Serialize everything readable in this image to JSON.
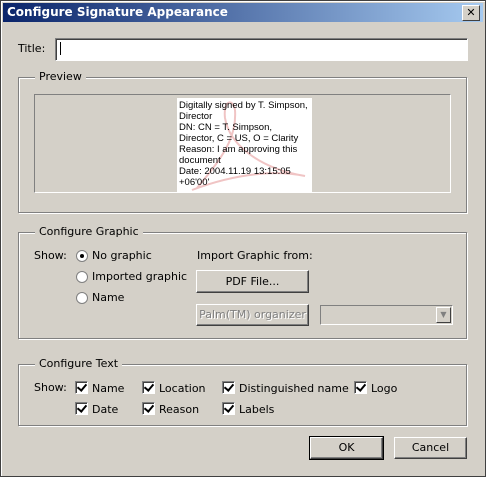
{
  "window": {
    "title": "Configure Signature Appearance",
    "close_glyph": "✕"
  },
  "title_field": {
    "label": "Title:",
    "value": ""
  },
  "preview": {
    "legend": "Preview",
    "signature_lines": [
      "Digitally signed by T. Simpson,",
      "Director",
      "DN: CN = T. Simpson,",
      "Director, C = US, O = Clarity",
      "Reason: I am approving this",
      "document",
      "Date: 2004.11.19 13:15:05",
      "+06'00'"
    ]
  },
  "configure_graphic": {
    "legend": "Configure Graphic",
    "show_label": "Show:",
    "options": [
      "No graphic",
      "Imported graphic",
      "Name"
    ],
    "selected": "No graphic",
    "import_label": "Import Graphic from:",
    "pdf_button": "PDF File...",
    "palm_button": "Palm(TM) organizer",
    "palm_select_value": ""
  },
  "configure_text": {
    "legend": "Configure Text",
    "show_label": "Show:",
    "items": [
      {
        "label": "Name",
        "checked": true
      },
      {
        "label": "Location",
        "checked": true
      },
      {
        "label": "Distinguished name",
        "checked": true
      },
      {
        "label": "Logo",
        "checked": true
      },
      {
        "label": "Date",
        "checked": true
      },
      {
        "label": "Reason",
        "checked": true
      },
      {
        "label": "Labels",
        "checked": true
      }
    ]
  },
  "buttons": {
    "ok": "OK",
    "cancel": "Cancel"
  }
}
